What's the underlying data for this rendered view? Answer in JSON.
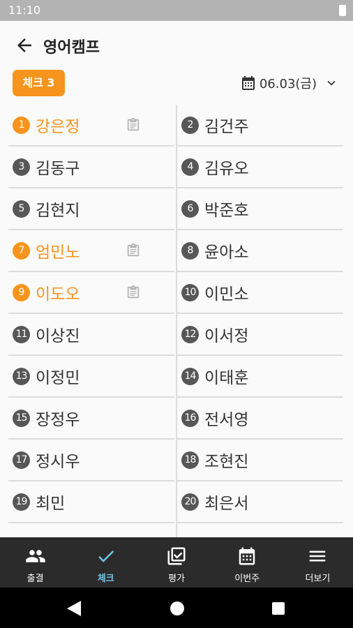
{
  "status_bar": {
    "time": "11:10"
  },
  "app_bar": {
    "title": "영어캠프"
  },
  "check_badge": {
    "label": "체크 3"
  },
  "date_picker": {
    "date": "06.03(금)"
  },
  "colors": {
    "accent": "#f7941d",
    "active_nav": "#6fc8e8",
    "badge_default": "#575757"
  },
  "students": [
    {
      "num": "1",
      "name": "강은정",
      "checked": true,
      "memo": true
    },
    {
      "num": "2",
      "name": "김건주",
      "checked": false,
      "memo": false
    },
    {
      "num": "3",
      "name": "김동구",
      "checked": false,
      "memo": false
    },
    {
      "num": "4",
      "name": "김유오",
      "checked": false,
      "memo": false
    },
    {
      "num": "5",
      "name": "김현지",
      "checked": false,
      "memo": false
    },
    {
      "num": "6",
      "name": "박준호",
      "checked": false,
      "memo": false
    },
    {
      "num": "7",
      "name": "엄민노",
      "checked": true,
      "memo": true
    },
    {
      "num": "8",
      "name": "윤아소",
      "checked": false,
      "memo": false
    },
    {
      "num": "9",
      "name": "이도오",
      "checked": true,
      "memo": true
    },
    {
      "num": "10",
      "name": "이민소",
      "checked": false,
      "memo": false
    },
    {
      "num": "11",
      "name": "이상진",
      "checked": false,
      "memo": false
    },
    {
      "num": "12",
      "name": "이서정",
      "checked": false,
      "memo": false
    },
    {
      "num": "13",
      "name": "이정민",
      "checked": false,
      "memo": false
    },
    {
      "num": "14",
      "name": "이태훈",
      "checked": false,
      "memo": false
    },
    {
      "num": "15",
      "name": "장정우",
      "checked": false,
      "memo": false
    },
    {
      "num": "16",
      "name": "전서영",
      "checked": false,
      "memo": false
    },
    {
      "num": "17",
      "name": "정시우",
      "checked": false,
      "memo": false
    },
    {
      "num": "18",
      "name": "조현진",
      "checked": false,
      "memo": false
    },
    {
      "num": "19",
      "name": "최민",
      "checked": false,
      "memo": false
    },
    {
      "num": "20",
      "name": "최은서",
      "checked": false,
      "memo": false
    }
  ],
  "bottom_nav": [
    {
      "label": "출결",
      "icon": "people-icon",
      "active": false
    },
    {
      "label": "체크",
      "icon": "check-icon",
      "active": true
    },
    {
      "label": "평가",
      "icon": "checkbox-list-icon",
      "active": false
    },
    {
      "label": "이번주",
      "icon": "calendar-icon",
      "active": false
    },
    {
      "label": "더보기",
      "icon": "menu-icon",
      "active": false
    }
  ]
}
